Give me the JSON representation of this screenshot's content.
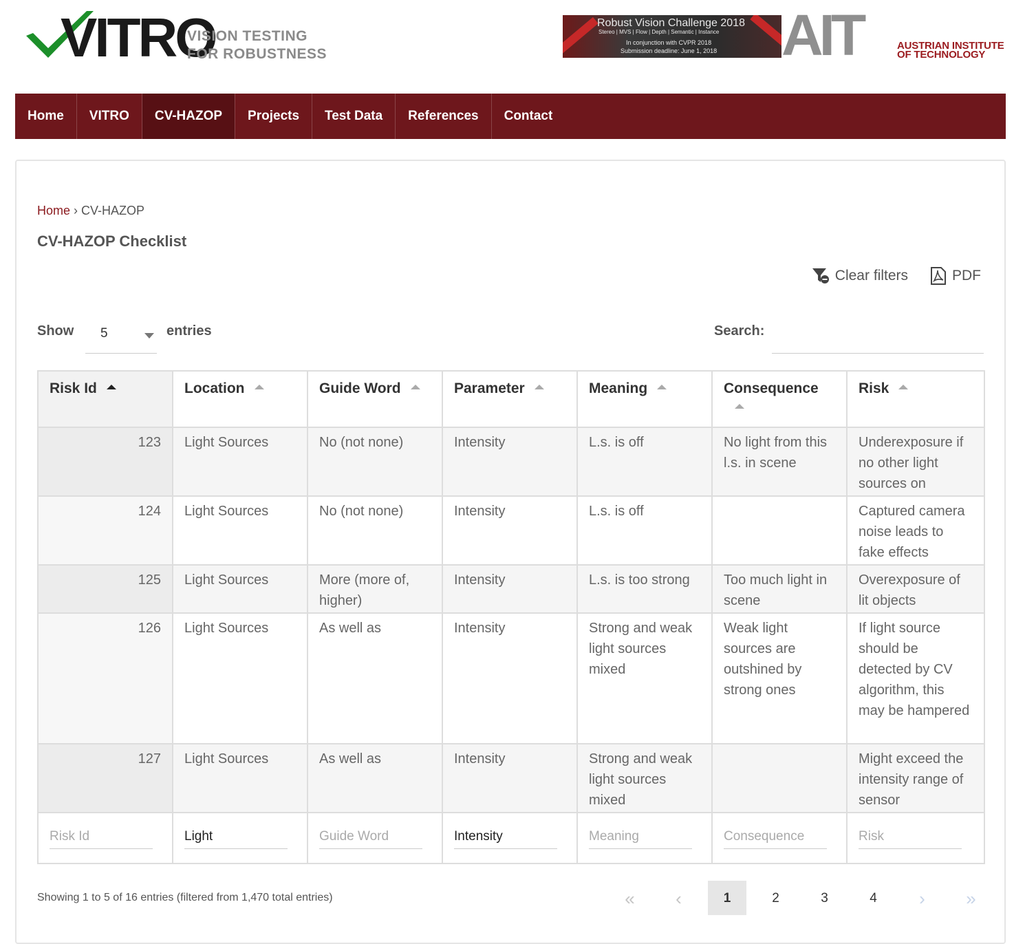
{
  "header": {
    "logo_text": "VITRO",
    "tagline_line1": "VISION TESTING",
    "tagline_line2": "FOR ROBUSTNESS",
    "banner": {
      "title": "Robust Vision Challenge 2018",
      "subtitle": "Stereo | MVS | Flow | Depth | Semantic | Instance",
      "line3": "In conjunction with CVPR 2018",
      "line4": "Submission deadline: June 1, 2018"
    },
    "ait_letters": "AIT",
    "ait_line1": "AUSTRIAN INSTITUTE",
    "ait_line2": "OF TECHNOLOGY"
  },
  "nav": {
    "items": [
      "Home",
      "VITRO",
      "CV-HAZOP",
      "Projects",
      "Test Data",
      "References",
      "Contact"
    ],
    "active": "CV-HAZOP"
  },
  "breadcrumb": {
    "home": "Home",
    "sep": " › ",
    "current": "CV-HAZOP"
  },
  "page_title": "CV-HAZOP Checklist",
  "tools": {
    "clear_filters": "Clear filters",
    "pdf": "PDF"
  },
  "length": {
    "show": "Show",
    "value": "5",
    "entries": "entries"
  },
  "search": {
    "label": "Search:",
    "value": ""
  },
  "table": {
    "columns": [
      "Risk Id",
      "Location",
      "Guide Word",
      "Parameter",
      "Meaning",
      "Consequence",
      "Risk"
    ],
    "rows": [
      [
        "123",
        "Light Sources",
        "No (not none)",
        "Intensity",
        "L.s. is off",
        "No light from this l.s. in scene",
        "Underexposure if no other light sources on"
      ],
      [
        "124",
        "Light Sources",
        "No (not none)",
        "Intensity",
        "L.s. is off",
        "",
        "Captured camera noise leads to fake effects"
      ],
      [
        "125",
        "Light Sources",
        "More (more of, higher)",
        "Intensity",
        "L.s. is too strong",
        "Too much light in scene",
        "Overexposure of lit objects"
      ],
      [
        "126",
        "Light Sources",
        "As well as",
        "Intensity",
        "Strong and weak light sources mixed",
        "Weak light sources are outshined by strong ones",
        "If light source should be detected by CV algorithm, this may be hampered"
      ],
      [
        "127",
        "Light Sources",
        "As well as",
        "Intensity",
        "Strong and weak light sources mixed",
        "",
        "Might exceed the intensity range of sensor"
      ]
    ],
    "filters": {
      "placeholders": [
        "Risk Id",
        "Location",
        "Guide Word",
        "Parameter",
        "Meaning",
        "Consequence",
        "Risk"
      ],
      "values": [
        "",
        "Light",
        "",
        "Intensity",
        "",
        "",
        ""
      ]
    }
  },
  "info": "Showing 1 to 5 of 16 entries (filtered from 1,470 total entries)",
  "pagination": {
    "first": "«",
    "prev": "‹",
    "pages": [
      "1",
      "2",
      "3",
      "4"
    ],
    "current": "1",
    "next": "›",
    "last": "»"
  }
}
